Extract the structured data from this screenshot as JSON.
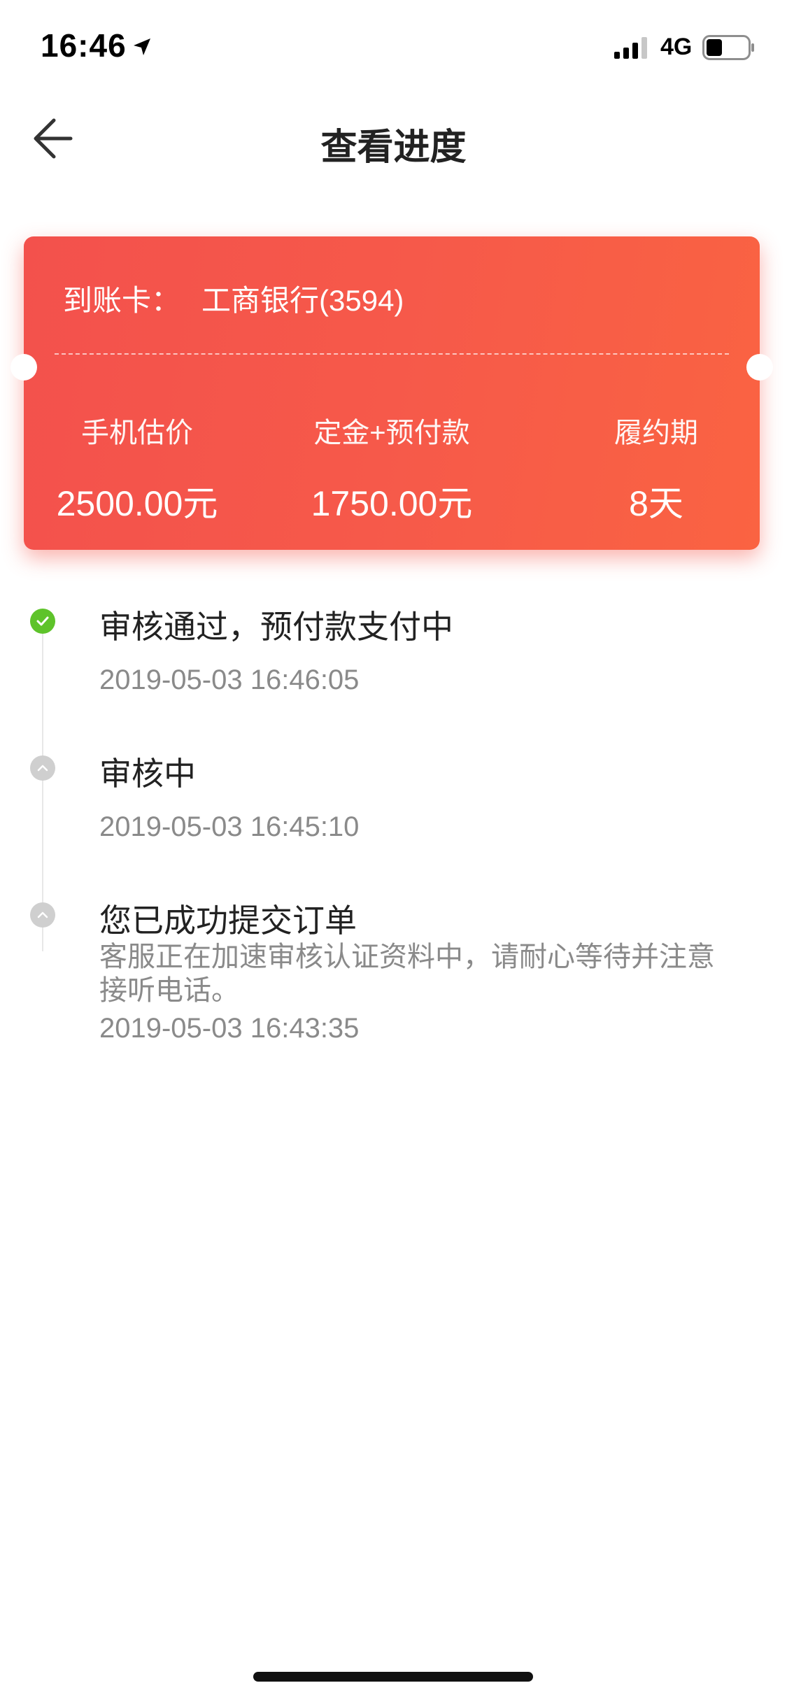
{
  "status_bar": {
    "time": "16:46",
    "network": "4G",
    "icons": [
      "location-arrow-icon",
      "signal-bars-icon",
      "battery-icon"
    ]
  },
  "nav": {
    "title": "查看进度",
    "back_icon": "arrow-left-icon"
  },
  "card": {
    "account_label": "到账卡：",
    "account_value": "工商银行(3594)",
    "columns": [
      {
        "label": "手机估价",
        "value": "2500.00元"
      },
      {
        "label": "定金+预付款",
        "value": "1750.00元"
      },
      {
        "label": "履约期",
        "value": "8天"
      }
    ],
    "colors": {
      "start": "#f3514c",
      "end": "#fa6342"
    }
  },
  "timeline": {
    "items": [
      {
        "status": "done",
        "title": "审核通过，预付款支付中",
        "desc": "",
        "time": "2019-05-03 16:46:05"
      },
      {
        "status": "pending",
        "title": "审核中",
        "desc": "",
        "time": "2019-05-03 16:45:10"
      },
      {
        "status": "pending",
        "title": "您已成功提交订单",
        "desc": "客服正在加速审核认证资料中，请耐心等待并注意接听电话。",
        "time": "2019-05-03 16:43:35"
      }
    ],
    "colors": {
      "done": "#5ec32a",
      "pending": "#cfcfcf"
    }
  }
}
